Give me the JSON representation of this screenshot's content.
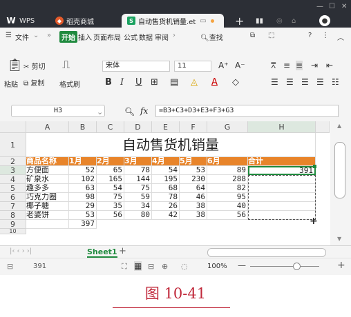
{
  "titlebar": {
    "app_tab": "WPS",
    "store_tab": "稻壳商城",
    "doc_tab": "自动售货机销量.et",
    "new_tab": "+"
  },
  "menu": {
    "file": "文件",
    "more": "»",
    "start": "开始",
    "items": [
      "插入",
      "页面布局",
      "公式",
      "数据",
      "审阅"
    ],
    "find": "查找",
    "help": "?",
    "more_dots": "⋮"
  },
  "toolbar": {
    "paste": "粘贴",
    "cut": "剪切",
    "copy": "复制",
    "format_painter": "格式刷",
    "font_name": "宋体",
    "font_size": "11",
    "bold": "B",
    "italic": "I",
    "underline": "U",
    "grow": "A⁺",
    "shrink": "A⁻"
  },
  "formula_bar": {
    "cell_ref": "H3",
    "fx": "fx",
    "formula": "=B3+C3+D3+E3+F3+G3"
  },
  "columns": [
    "A",
    "B",
    "C",
    "D",
    "E",
    "F",
    "G",
    "H"
  ],
  "rows": [
    "1",
    "2",
    "3",
    "4",
    "5",
    "6",
    "7",
    "8",
    "9",
    "10"
  ],
  "sheet_title": "自动售货机销量",
  "headers": [
    "商品名称",
    "1月",
    "2月",
    "3月",
    "4月",
    "5月",
    "6月",
    "合计"
  ],
  "table": [
    {
      "name": "方便面",
      "vals": [
        "52",
        "65",
        "78",
        "54",
        "53",
        "89"
      ],
      "total": "391"
    },
    {
      "name": "矿泉水",
      "vals": [
        "102",
        "165",
        "144",
        "195",
        "230",
        "288"
      ],
      "total": ""
    },
    {
      "name": "趣多多",
      "vals": [
        "63",
        "54",
        "75",
        "68",
        "64",
        "82"
      ],
      "total": ""
    },
    {
      "name": "巧克力圈",
      "vals": [
        "98",
        "75",
        "59",
        "78",
        "46",
        "95"
      ],
      "total": ""
    },
    {
      "name": "椰子糖",
      "vals": [
        "29",
        "35",
        "34",
        "26",
        "38",
        "40"
      ],
      "total": ""
    },
    {
      "name": "老婆饼",
      "vals": [
        "53",
        "56",
        "80",
        "42",
        "38",
        "56"
      ],
      "total": ""
    }
  ],
  "row9_b": "397",
  "sheet_tab": "Sheet1",
  "status": {
    "sum": "391",
    "zoom": "100%"
  },
  "caption": "图 10-41",
  "colors": {
    "accent": "#1f8a3e",
    "header_fill": "#e8842a",
    "caption": "#c0283a"
  }
}
